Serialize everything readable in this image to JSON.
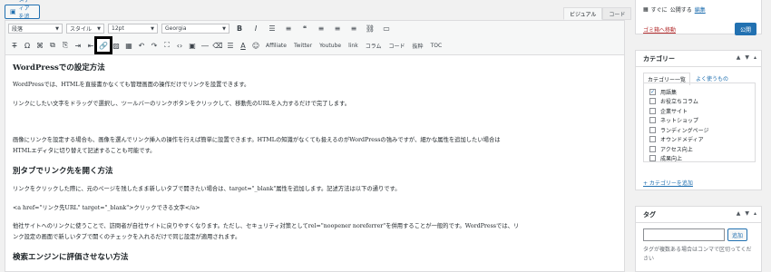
{
  "media_button": {
    "label": "メディアを追加"
  },
  "editor_tabs": [
    "ビジュアル",
    "コード"
  ],
  "toolbar": {
    "format_select": "段落",
    "style_select": "スタイル",
    "size_select": "12pt",
    "font_select": "Georgia",
    "qt_buttons": [
      "Affiliate",
      "Twitter",
      "Youtube",
      "link",
      "コラム",
      "コード",
      "抜粋",
      "TOC"
    ]
  },
  "content": {
    "h1": "WordPressでの設定方法",
    "p1": "WordPressでは、HTMLを直接書かなくても管理画面の操作だけでリンクを設置できます。",
    "p2": "リンクにしたい文字をドラッグで選択し、ツールバーのリンクボタンをクリックして、移動先のURLを入力するだけで完了します。",
    "p3a": "画像にリンクを設定する場合も、画像を選んでリンク挿入の操作を行えば簡単に設置できます。HTMLの知識がなくても扱えるのがWordPressの強みですが、細かな属性を追加したい場合は",
    "p3b": "HTMLエディタに切り替えて記述することも可能です。",
    "h2": "別タブでリンク先を開く方法",
    "p4": "リンクをクリックした際に、元のページを残したまま新しいタブで開きたい場合は、target=\"_blank\"属性を追加します。記述方法は以下の通りです。",
    "p5": "<a href=\"リンク先URL\" target=\"_blank\">クリックできる文字</a>",
    "p6a": "他社サイトへのリンクに使うことで、訪問者が自社サイトに戻りやすくなります。ただし、セキュリティ対策としてrel=\"noopener noreferrer\"を併用することが一般的です。WordPressでは、リ",
    "p6b": "ンク設定の画面で新しいタブで開くのチェックを入れるだけで同じ設定が適用されます。",
    "h3": "検索エンジンに評価させない方法"
  },
  "publish": {
    "publish_now_label": "すぐに",
    "publish_now_link": "公開する",
    "edit_link": "編集",
    "trash_link": "ゴミ箱へ移動",
    "publish_button": "公開"
  },
  "category": {
    "title": "カテゴリー",
    "tab_all": "カテゴリー一覧",
    "tab_popular": "よく使うもの",
    "items": [
      {
        "label": "用語集",
        "checked": true
      },
      {
        "label": "お役立ちコラム",
        "checked": false
      },
      {
        "label": "企業サイト",
        "checked": false
      },
      {
        "label": "ネットショップ",
        "checked": false
      },
      {
        "label": "ランディングページ",
        "checked": false
      },
      {
        "label": "オウンドメディア",
        "checked": false
      },
      {
        "label": "アクセス向上",
        "checked": false
      },
      {
        "label": "成果向上",
        "checked": false
      }
    ],
    "add_new": "+ カテゴリーを追加"
  },
  "tags": {
    "title": "タグ",
    "add_button": "追加",
    "help": "タグが複数ある場合はコンマで区切ってください"
  }
}
